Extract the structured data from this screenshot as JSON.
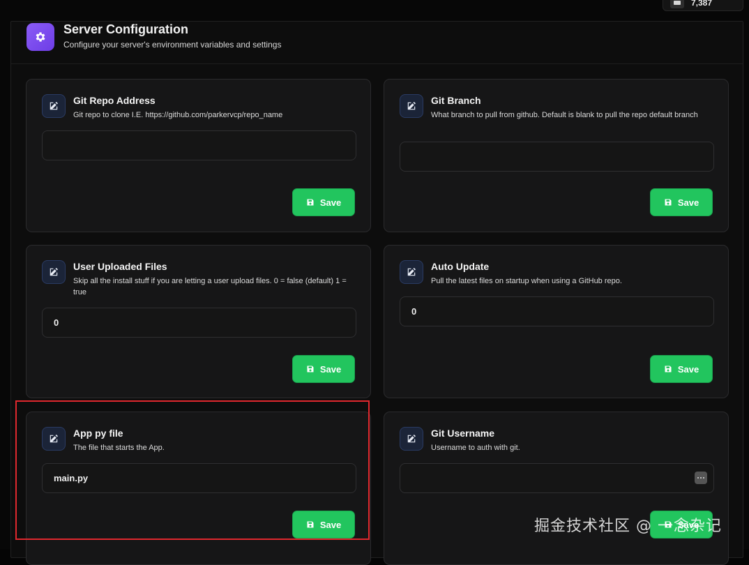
{
  "top_chip": {
    "value": "7,387"
  },
  "header": {
    "title": "Server Configuration",
    "subtitle": "Configure your server's environment variables and settings"
  },
  "cards": [
    {
      "title": "Git Repo Address",
      "description": "Git repo to clone I.E. https://github.com/parkervcp/repo_name",
      "value": "",
      "save_label": "Save"
    },
    {
      "title": "Git Branch",
      "description": "What branch to pull from github. Default is blank to pull the repo default branch",
      "value": "",
      "save_label": "Save"
    },
    {
      "title": "User Uploaded Files",
      "description": "Skip all the install stuff if you are letting a user upload files. 0 = false (default) 1 = true",
      "value": "0",
      "save_label": "Save"
    },
    {
      "title": "Auto Update",
      "description": "Pull the latest files on startup when using a GitHub repo.",
      "value": "0",
      "save_label": "Save"
    },
    {
      "title": "App py file",
      "description": "The file that starts the App.",
      "value": "main.py",
      "save_label": "Save"
    },
    {
      "title": "Git Username",
      "description": "Username to auth with git.",
      "value": "",
      "save_label": "Save"
    }
  ],
  "watermark": "掘金技术社区 @ 一念杂记",
  "colors": {
    "accent_purple": "#8b5cf6",
    "save_green": "#22c55e",
    "highlight_red": "#e0282e"
  },
  "icons": {
    "header": "gear-icon",
    "card": "edit-icon",
    "save": "floppy-disk-icon"
  }
}
